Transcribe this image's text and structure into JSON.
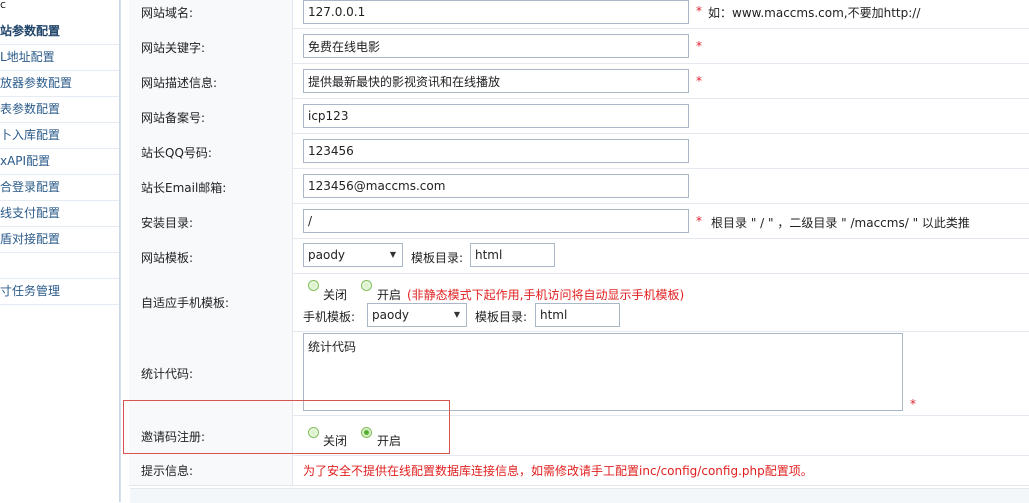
{
  "sidebar": {
    "header": "c",
    "items": [
      {
        "label": "站参数配置",
        "active": true
      },
      {
        "label": "L地址配置",
        "active": false
      },
      {
        "label": "放器参数配置",
        "active": false
      },
      {
        "label": "表参数配置",
        "active": false
      },
      {
        "label": "卜入库配置",
        "active": false
      },
      {
        "label": "xAPI配置",
        "active": false
      },
      {
        "label": "合登录配置",
        "active": false
      },
      {
        "label": "线支付配置",
        "active": false
      },
      {
        "label": "盾对接配置",
        "active": false
      },
      {
        "label": "",
        "active": false
      },
      {
        "label": "寸任务管理",
        "active": false
      }
    ]
  },
  "form": {
    "site_domain": {
      "label": "网站域名:",
      "value": "127.0.0.1",
      "required": "*",
      "hint": "如：www.maccms.com,不要加http://"
    },
    "site_keywords": {
      "label": "网站关键字:",
      "value": "免费在线电影",
      "required": "*"
    },
    "site_description": {
      "label": "网站描述信息:",
      "value": "提供最新最快的影视资讯和在线播放",
      "required": "*"
    },
    "site_icp": {
      "label": "网站备案号:",
      "value": "icp123"
    },
    "admin_qq": {
      "label": "站长QQ号码:",
      "value": "123456"
    },
    "admin_email": {
      "label": "站长Email邮箱:",
      "value": "123456@maccms.com"
    },
    "install_dir": {
      "label": "安装目录:",
      "value": "/",
      "required": "*",
      "hint": "根目录 \" / \" ，二级目录 \" /maccms/ \" 以此类推"
    },
    "site_template": {
      "label": "网站模板:",
      "select_value": "paody",
      "dir_label": "模板目录:",
      "dir_value": "html"
    },
    "mobile_template": {
      "label": "自适应手机模板:",
      "option_off": "关闭",
      "option_on": "开启",
      "note": "(非静态模式下起作用,手机访问将自动显示手机模板)",
      "mobile_label": "手机模板:",
      "select_value": "paody",
      "dir_label": "模板目录:",
      "dir_value": "html"
    },
    "stats_code": {
      "label": "统计代码:",
      "value": "统计代码",
      "required": "*"
    },
    "invite_code": {
      "label": "邀请码注册:",
      "option_off": "关闭",
      "option_on": "开启",
      "selected": "开启"
    },
    "notice": {
      "label": "提示信息:",
      "text": "为了安全不提供在线配置数据库连接信息，如需修改请手工配置inc/config/config.php配置项。"
    }
  },
  "colors": {
    "required": "#dd2233",
    "notice": "#e02020",
    "highlight": "#d9534f",
    "label_bg": "#f7f9fb"
  }
}
